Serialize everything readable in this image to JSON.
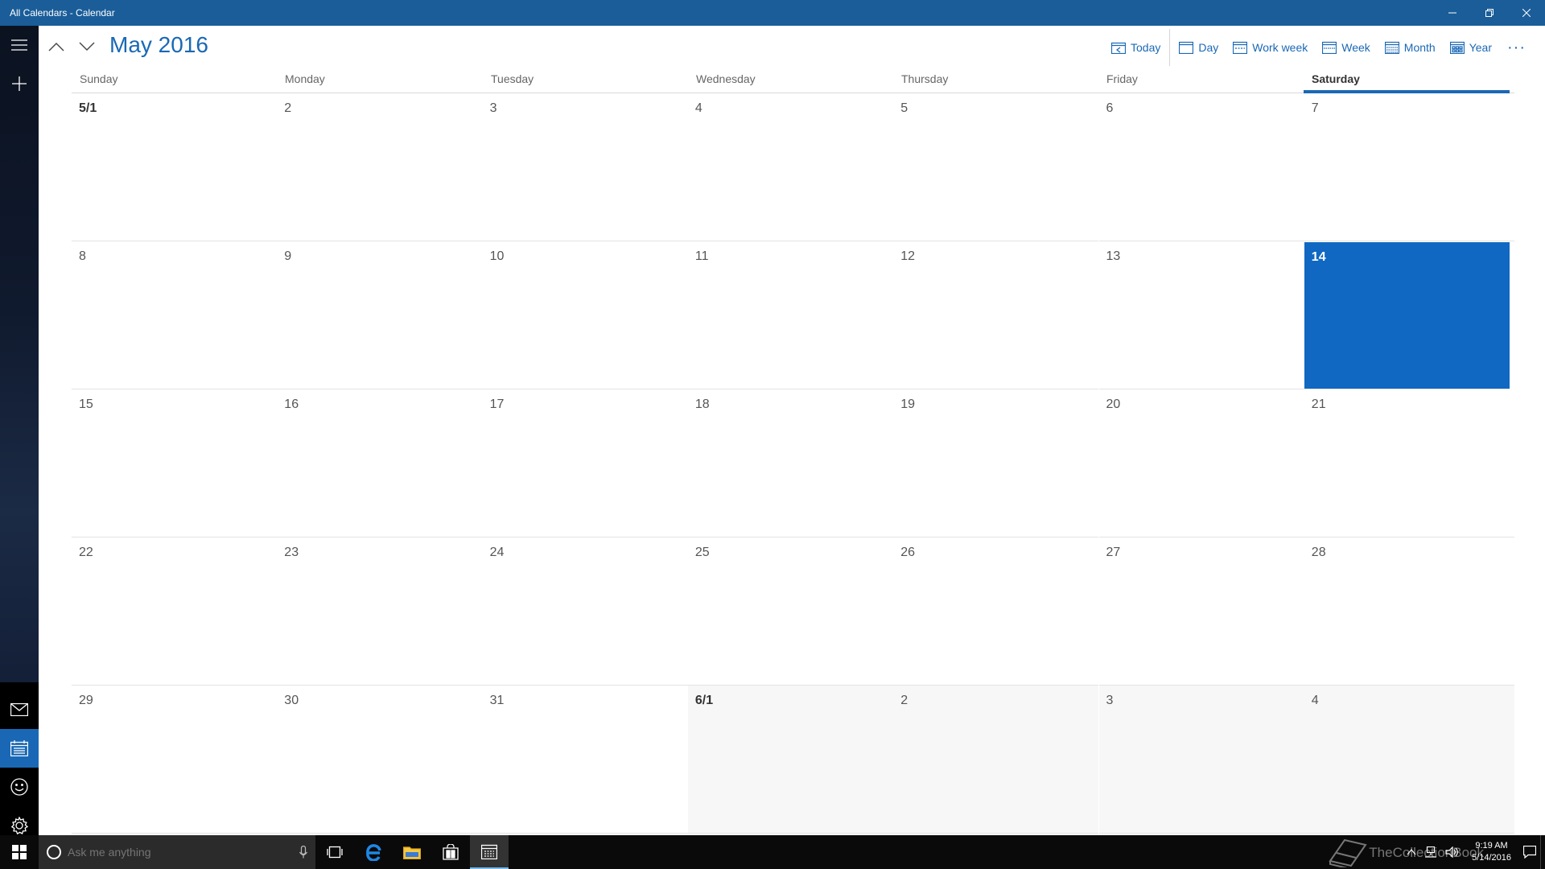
{
  "window": {
    "title": "All Calendars - Calendar"
  },
  "header": {
    "month_title": "May 2016",
    "toolbar": {
      "today": "Today",
      "day": "Day",
      "work_week": "Work week",
      "week": "Week",
      "month": "Month",
      "year": "Year",
      "more": "···"
    }
  },
  "calendar": {
    "weekdays": [
      "Sunday",
      "Monday",
      "Tuesday",
      "Wednesday",
      "Thursday",
      "Friday",
      "Saturday"
    ],
    "today_weekday_index": 6,
    "weeks": [
      [
        "5/1",
        "2",
        "3",
        "4",
        "5",
        "6",
        "7"
      ],
      [
        "8",
        "9",
        "10",
        "11",
        "12",
        "13",
        "14"
      ],
      [
        "15",
        "16",
        "17",
        "18",
        "19",
        "20",
        "21"
      ],
      [
        "22",
        "23",
        "24",
        "25",
        "26",
        "27",
        "28"
      ],
      [
        "29",
        "30",
        "31",
        "6/1",
        "2",
        "3",
        "4"
      ]
    ],
    "today": "14",
    "accent_color": "#1068c2"
  },
  "taskbar": {
    "search_placeholder": "Ask me anything",
    "clock_time": "9:19 AM",
    "clock_date": "5/14/2016",
    "watermark": "TheCollectionBook"
  }
}
